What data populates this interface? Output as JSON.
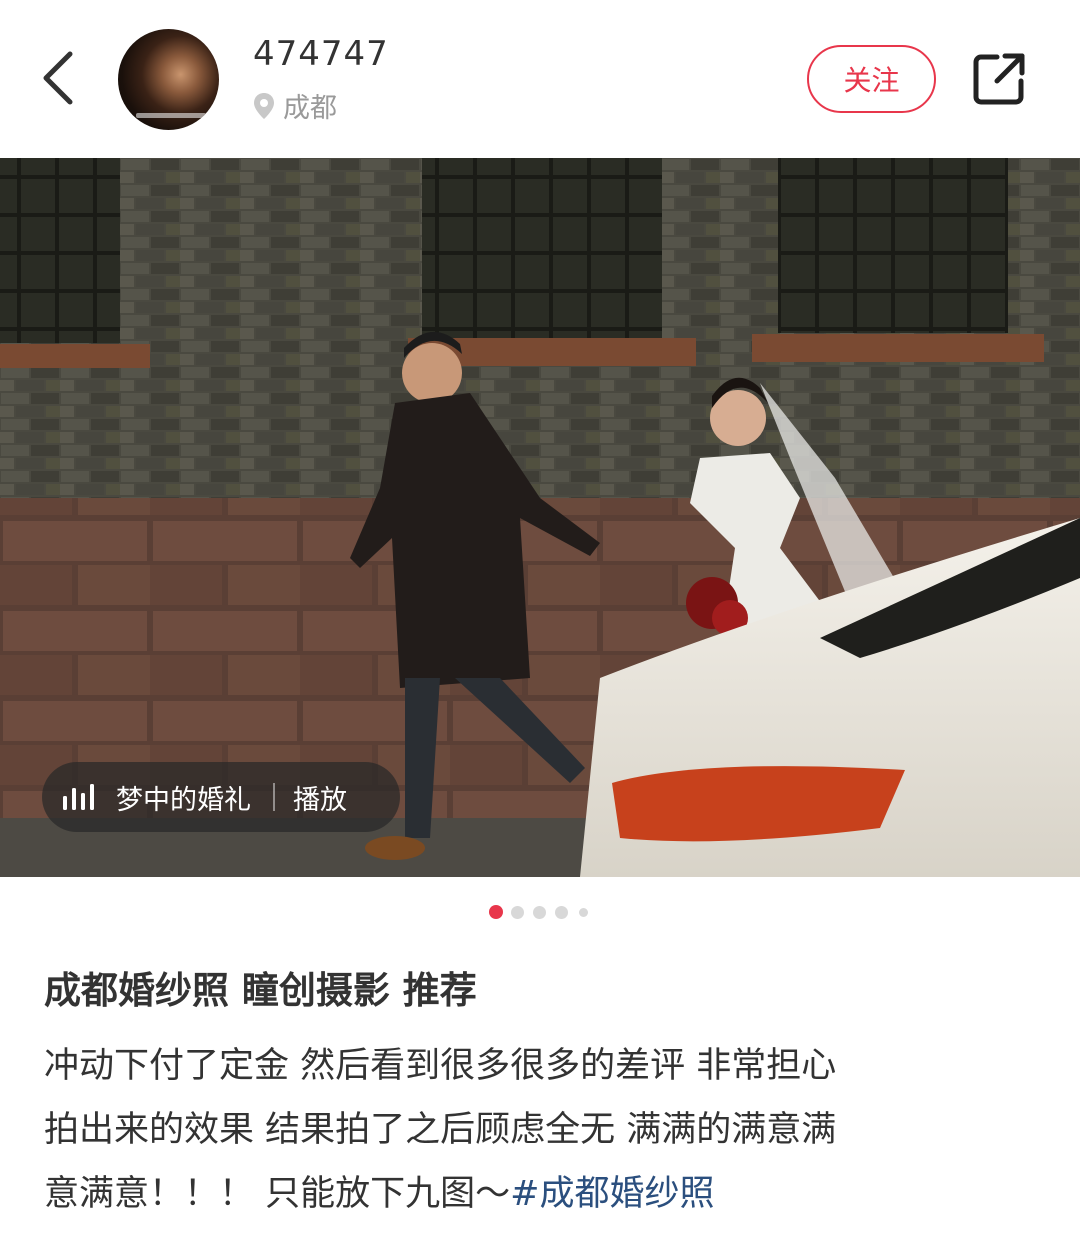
{
  "header": {
    "username": "474747",
    "location": "成都",
    "follow_label": "关注"
  },
  "icons": {
    "back": "chevron-left-icon",
    "location": "location-pin-icon",
    "share": "share-external-icon",
    "music": "music-bars-icon"
  },
  "music": {
    "title": "梦中的婚礼",
    "action": "播放"
  },
  "carousel": {
    "total": 5,
    "active_index": 0
  },
  "post": {
    "title": "成都婚纱照 瞳创摄影 推荐",
    "body_lines": [
      "冲动下付了定金 然后看到很多很多的差评 非常担心",
      "拍出来的效果 结果拍了之后顾虑全无 满满的满意满",
      "意满意！！！ 只能放下九图～"
    ],
    "hashtag": "#成都婚纱照"
  },
  "colors": {
    "accent": "#e8364b",
    "hashtag": "#2b4f7e",
    "text": "#333333",
    "muted": "#9a9a9a"
  }
}
